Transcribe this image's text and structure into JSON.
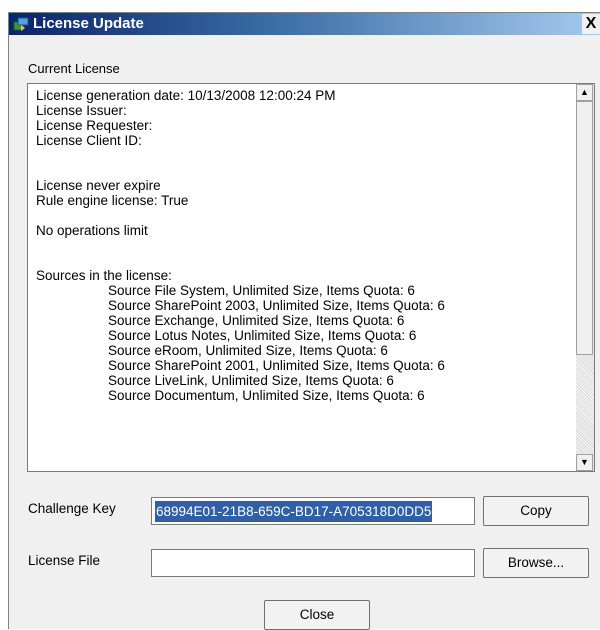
{
  "window": {
    "title": "License Update",
    "close_glyph": "X",
    "icon": "license-app-icon"
  },
  "current_license": {
    "label": "Current License",
    "lines": [
      "License generation date: 10/13/2008 12:00:24 PM",
      "License Issuer:",
      "License Requester:",
      "License Client ID:",
      "",
      "",
      "License never expire",
      "Rule engine license: True",
      "",
      "No operations limit",
      "",
      "",
      "Sources in the license:"
    ],
    "sources": [
      "Source File System, Unlimited Size, Items Quota: 6",
      "Source SharePoint 2003, Unlimited Size, Items Quota: 6",
      "Source Exchange, Unlimited Size, Items Quota: 6",
      "Source Lotus Notes, Unlimited Size, Items Quota: 6",
      "Source eRoom, Unlimited Size, Items Quota: 6",
      "Source SharePoint 2001, Unlimited Size, Items Quota: 6",
      "Source LiveLink, Unlimited Size, Items Quota: 6",
      "Source Documentum, Unlimited Size, Items Quota: 6"
    ]
  },
  "challenge": {
    "label": "Challenge Key",
    "value": "68994E01-21B8-659C-BD17-A705318D0DD5",
    "copy_label": "Copy"
  },
  "license_file": {
    "label": "License File",
    "value": "",
    "browse_label": "Browse..."
  },
  "footer": {
    "close_label": "Close"
  },
  "colors": {
    "title_bar_start": "#0a246a",
    "title_bar_end": "#a6caf0",
    "selection": "#2f5fa8",
    "dialog_bg": "#f0f0f0"
  }
}
